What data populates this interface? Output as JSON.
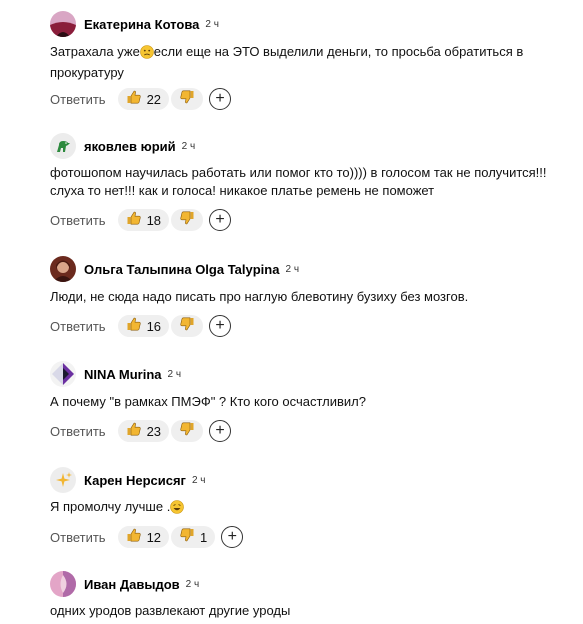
{
  "ui": {
    "reply_label": "Ответить",
    "add_reaction_symbol": "+"
  },
  "comments": [
    {
      "author": "Екатерина Котова",
      "time": "2 ч",
      "text_before": "Затрахала уже",
      "emoji": "confused-face",
      "text_after": "если еще на ЭТО выделили деньги, то просьба обратиться в прокуратуру",
      "likes": "22",
      "dislikes": ""
    },
    {
      "author": "яковлев юрий",
      "time": "2 ч",
      "text": "фотошопом научилась работать или помог кто то)))) в голосом так не получится!!! слуха то нет!!! как и голоса! никакое платье ремень не поможет",
      "likes": "18",
      "dislikes": ""
    },
    {
      "author": "Ольга Талыпина Olga Talypina",
      "time": "2 ч",
      "text": "Люди, не сюда надо писать про наглую блевотину бузиху без мозгов.",
      "likes": "16",
      "dislikes": ""
    },
    {
      "author": "NINA Murina",
      "time": "2 ч",
      "text": "А почему \"в рамках ПМЭФ\" ? Кто кого осчастливил?",
      "likes": "23",
      "dislikes": ""
    },
    {
      "author": "Карен Нерсисяг",
      "time": "2 ч",
      "text_before": "Я промолчу лучше .",
      "emoji": "laughing-face",
      "text_after": "",
      "likes": "12",
      "dislikes": "1"
    },
    {
      "author": "Иван Давыдов",
      "time": "2 ч",
      "text": "одних уродов развлекают другие уроды"
    }
  ]
}
